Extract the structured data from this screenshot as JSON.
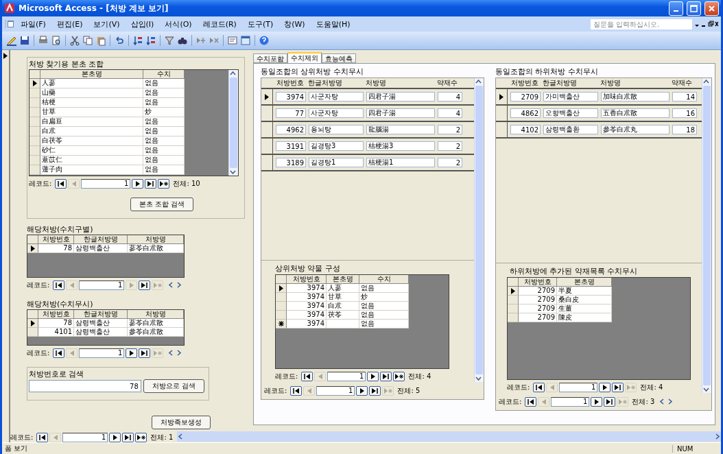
{
  "window": {
    "title": "Microsoft Access - [처방 계보 보기]"
  },
  "menu": [
    "파일(F)",
    "편집(E)",
    "보기(V)",
    "삽입(I)",
    "서식(O)",
    "레코드(R)",
    "도구(T)",
    "창(W)",
    "도움말(H)"
  ],
  "help_box": {
    "placeholder": "질문을 입력하십시오."
  },
  "herb_search": {
    "title": "처방 찾기용 본초 조합",
    "table": {
      "columns": [
        "본초명",
        "수치"
      ],
      "rows": [
        {
          "selected": true,
          "cells": [
            "人蔘",
            "없음"
          ]
        },
        {
          "selected": false,
          "cells": [
            "山藥",
            "없음"
          ]
        },
        {
          "selected": false,
          "cells": [
            "桔梗",
            "없음"
          ]
        },
        {
          "selected": false,
          "cells": [
            "甘草",
            "炒"
          ]
        },
        {
          "selected": false,
          "cells": [
            "白扁豆",
            "없음"
          ]
        },
        {
          "selected": false,
          "cells": [
            "白朮",
            "없음"
          ]
        },
        {
          "selected": false,
          "cells": [
            "白茯苓",
            "없음"
          ]
        },
        {
          "selected": false,
          "cells": [
            "砂仁",
            "없음"
          ]
        },
        {
          "selected": false,
          "cells": [
            "薏苡仁",
            "없음"
          ]
        },
        {
          "selected": false,
          "cells": [
            "蓮子肉",
            "없음"
          ]
        }
      ]
    },
    "nav": {
      "label": "레코드:",
      "value": "1",
      "total": "전체: 10",
      "prev_enabled": false,
      "next_enabled": true,
      "new_enabled": true
    },
    "button": "본초 조합 검색"
  },
  "matches_by_processing": {
    "title": "해당처방(수치구별)",
    "table": {
      "columns": [
        "처방번호",
        "한글처방명",
        "처방명"
      ],
      "rows": [
        {
          "selected": true,
          "cells": [
            "78",
            "삼령백출산",
            "蔘苓白朮散"
          ]
        }
      ]
    },
    "nav": {
      "label": "레코드:",
      "value": "1",
      "prev_enabled": false,
      "next_enabled": false,
      "new_enabled": false,
      "scroll_arrows": true
    }
  },
  "matches_ignoring_processing": {
    "title": "해당처방(수치무시)",
    "table": {
      "columns": [
        "처방번호",
        "한글처방명",
        "처방명"
      ],
      "rows": [
        {
          "selected": true,
          "cells": [
            "78",
            "삼령백출산",
            "蔘苓白朮散"
          ]
        },
        {
          "selected": false,
          "cells": [
            "4101",
            "삼령백출산",
            "參苓白朮散"
          ]
        }
      ]
    },
    "nav": {
      "label": "레코드:",
      "value": "1",
      "prev_enabled": false,
      "next_enabled": true,
      "new_enabled": false,
      "scroll_arrows": true
    }
  },
  "number_search": {
    "title": "처방번호로 검색",
    "value": "78",
    "button": "처방으로 검색"
  },
  "pedigree_button": "처방족보생성",
  "form_nav": {
    "label": "레코드:",
    "value": "1",
    "total": "전체: 1",
    "prev_enabled": false,
    "next_enabled": true,
    "new_enabled": true
  },
  "tabs": [
    {
      "label": "수치포함",
      "selected": false
    },
    {
      "label": "수치제외",
      "selected": true
    },
    {
      "label": "효능예측",
      "selected": false
    }
  ],
  "upper": {
    "title": "동일조합의 상위처방 수치무시",
    "columns": [
      "처방번호",
      "한글처방명",
      "처방명",
      "약재수"
    ],
    "rows": [
      {
        "selected": true,
        "cells": [
          "3974",
          "사군자탕",
          "四君子湯",
          "4"
        ]
      },
      {
        "selected": false,
        "cells": [
          "77",
          "사군자탕",
          "四君子湯",
          "4"
        ]
      },
      {
        "selected": false,
        "cells": [
          "4962",
          "용뇌탕",
          "龍腦湯",
          "2"
        ]
      },
      {
        "selected": false,
        "cells": [
          "3191",
          "길경탕3",
          "桔梗湯3",
          "2"
        ]
      },
      {
        "selected": false,
        "cells": [
          "3189",
          "길경탕1",
          "桔梗湯1",
          "2"
        ]
      }
    ],
    "subform": {
      "title": "상위처방 약물 구성",
      "table": {
        "columns": [
          "처방번호",
          "본초명",
          "수치"
        ],
        "rows": [
          {
            "selected": true,
            "new": false,
            "cells": [
              "3974",
              "人蔘",
              "없음"
            ]
          },
          {
            "selected": false,
            "new": false,
            "cells": [
              "3974",
              "甘草",
              "炒"
            ]
          },
          {
            "selected": false,
            "new": false,
            "cells": [
              "3974",
              "白朮",
              "없음"
            ]
          },
          {
            "selected": false,
            "new": false,
            "cells": [
              "3974",
              "茯苓",
              "없음"
            ]
          },
          {
            "selected": false,
            "new": true,
            "cells": [
              "3974",
              "",
              "없음"
            ]
          }
        ]
      },
      "nav": {
        "label": "레코드:",
        "value": "1",
        "total": "전체: 4",
        "prev_enabled": false,
        "next_enabled": true,
        "new_enabled": true
      }
    },
    "nav": {
      "label": "레코드:",
      "value": "1",
      "total": "전체: 5",
      "prev_enabled": false,
      "next_enabled": true,
      "new_enabled": false
    }
  },
  "lower": {
    "title": "동일조합의 하위처방 수치무시",
    "columns": [
      "처방번호",
      "한글처방명",
      "처방명",
      "약재수"
    ],
    "rows": [
      {
        "selected": true,
        "cells": [
          "2709",
          "가미백출산",
          "加味白朮散",
          "14"
        ]
      },
      {
        "selected": false,
        "cells": [
          "4862",
          "오향백출산",
          "五香白朮散",
          "16"
        ]
      },
      {
        "selected": false,
        "cells": [
          "4102",
          "삼령백출환",
          "參苓白朮丸",
          "18"
        ]
      }
    ],
    "subform": {
      "title": "하위처방에 추가된 약재목록 수치무시",
      "table": {
        "columns": [
          "처방번호",
          "본초명"
        ],
        "rows": [
          {
            "selected": true,
            "cells": [
              "2709",
              "半夏"
            ]
          },
          {
            "selected": false,
            "cells": [
              "2709",
              "桑白皮"
            ]
          },
          {
            "selected": false,
            "cells": [
              "2709",
              "生薑"
            ]
          },
          {
            "selected": false,
            "cells": [
              "2709",
              "陳皮"
            ]
          }
        ]
      },
      "nav": {
        "label": "레코드:",
        "value": "1",
        "total": "전체: 4",
        "prev_enabled": false,
        "next_enabled": true,
        "new_enabled": false
      }
    },
    "nav": {
      "label": "레코드:",
      "value": "1",
      "total": "전체: 3",
      "prev_enabled": false,
      "next_enabled": true,
      "new_enabled": false,
      "scroll_arrows": true
    }
  },
  "status_bar": {
    "mode": "폼 보기",
    "indicator": "NUM"
  }
}
